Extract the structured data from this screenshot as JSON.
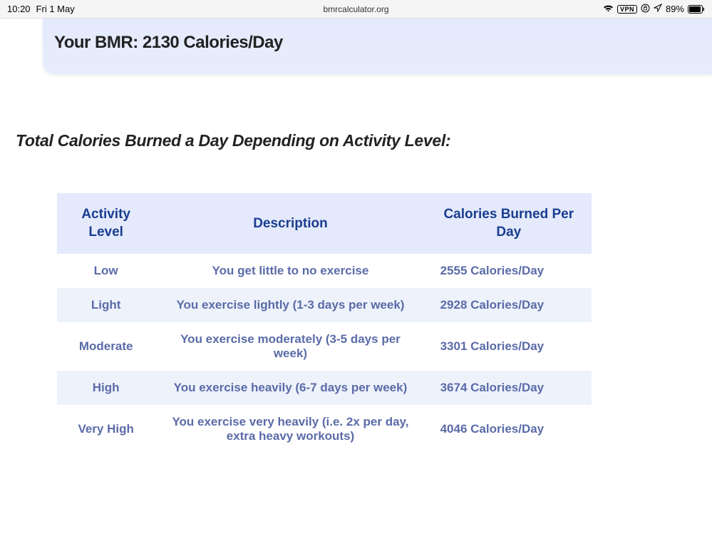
{
  "status_bar": {
    "time": "10:20",
    "date": "Fri 1 May",
    "url": "bmrcalculator.org",
    "vpn_label": "VPN",
    "battery_percent": "89%"
  },
  "bmr": {
    "title": "Your BMR: 2130 Calories/Day"
  },
  "section": {
    "heading": "Total Calories Burned a Day Depending on Activity Level:"
  },
  "table": {
    "headers": {
      "level": "Activity Level",
      "description": "Description",
      "calories": "Calories Burned Per Day"
    },
    "rows": [
      {
        "level": "Low",
        "description": "You get little to no exercise",
        "calories": "2555 Calories/Day"
      },
      {
        "level": "Light",
        "description": "You exercise lightly (1-3 days per week)",
        "calories": "2928 Calories/Day"
      },
      {
        "level": "Moderate",
        "description": "You exercise moderately (3-5 days per week)",
        "calories": "3301 Calories/Day"
      },
      {
        "level": "High",
        "description": "You exercise heavily (6-7 days per week)",
        "calories": "3674 Calories/Day"
      },
      {
        "level": "Very High",
        "description": "You exercise very heavily (i.e. 2x per day, extra heavy workouts)",
        "calories": "4046 Calories/Day"
      }
    ]
  }
}
